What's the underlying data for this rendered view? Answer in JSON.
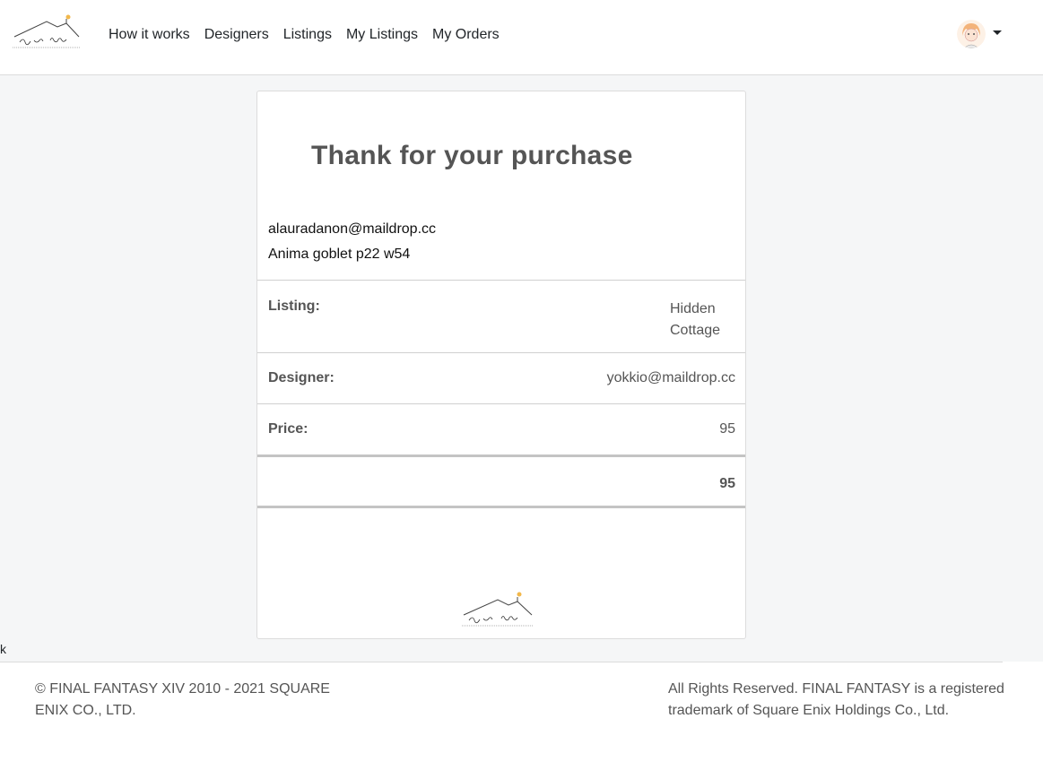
{
  "nav": {
    "links": [
      "How it works",
      "Designers",
      "Listings",
      "My Listings",
      "My Orders"
    ]
  },
  "order": {
    "title": "Thank for your purchase",
    "buyer_email": "alauradanon@maildrop.cc",
    "item": "Anima goblet p22 w54",
    "listing_label": "Listing:",
    "listing_value": "Hidden Cottage",
    "designer_label": "Designer:",
    "designer_value": "yokkio@maildrop.cc",
    "price_label": "Price:",
    "price_value": "95",
    "total_value": "95"
  },
  "stray_text": "k",
  "footer": {
    "left": "© FINAL FANTASY XIV 2010 - 2021 SQUARE ENIX CO., LTD.",
    "right": "All Rights Reserved. FINAL FANTASY is a registered trademark of Square Enix Holdings Co., Ltd."
  },
  "colors": {
    "page_background": "#f5f6f7",
    "text_muted": "#555555",
    "logo_sun": "#f2b84b"
  },
  "icons": {
    "brand_logo": "house-roof-logo-icon",
    "avatar": "user-avatar-icon",
    "dropdown": "caret-down-icon"
  }
}
